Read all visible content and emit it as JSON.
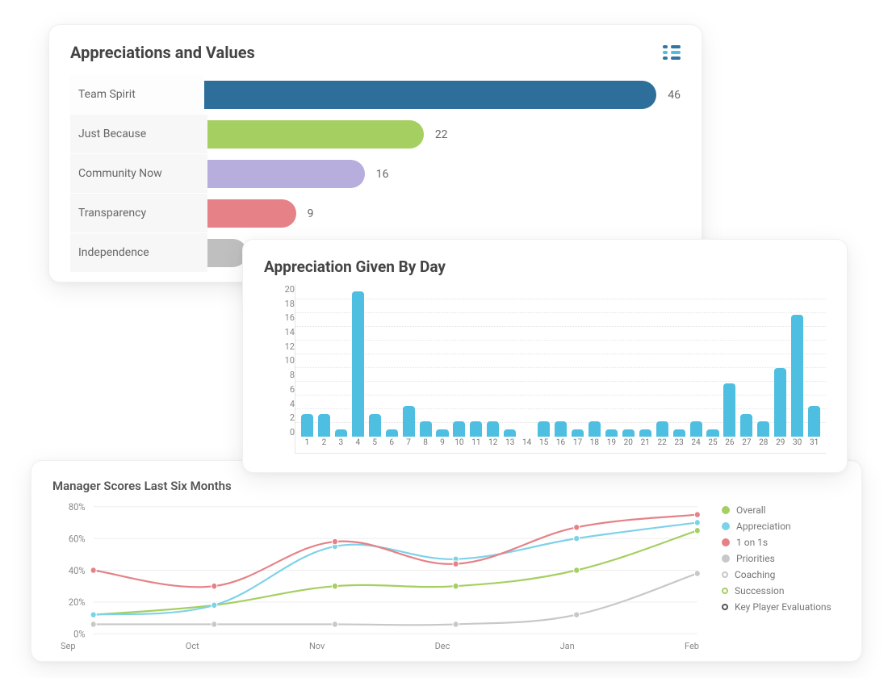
{
  "panel1": {
    "title": "Appreciations and Values",
    "legend_icon_colors": [
      "#2f77a1",
      "#4ebfe0",
      "#2f77a1"
    ]
  },
  "panel2": {
    "title": "Appreciation Given By Day"
  },
  "panel3": {
    "title": "Manager Scores Last Six Months"
  },
  "chart_data": [
    {
      "id": "appreciations_values",
      "type": "bar",
      "orientation": "horizontal",
      "title": "Appreciations and Values",
      "categories": [
        "Team Spirit",
        "Just Because",
        "Community Now",
        "Transparency",
        "Independence"
      ],
      "values": [
        46,
        22,
        16,
        9,
        4
      ],
      "colors": [
        "#2d6e9b",
        "#a5cf60",
        "#b7aedd",
        "#e58187",
        "#bfbfbf"
      ],
      "xmax": 46
    },
    {
      "id": "appreciation_by_day",
      "type": "bar",
      "orientation": "vertical",
      "title": "Appreciation Given By Day",
      "categories": [
        "1",
        "2",
        "3",
        "4",
        "5",
        "6",
        "7",
        "8",
        "9",
        "10",
        "11",
        "12",
        "13",
        "14",
        "15",
        "16",
        "17",
        "18",
        "19",
        "20",
        "21",
        "22",
        "23",
        "24",
        "25",
        "26",
        "27",
        "28",
        "29",
        "30",
        "31"
      ],
      "values": [
        3,
        3,
        1,
        19,
        3,
        1,
        4,
        2,
        1,
        2,
        2,
        2,
        1,
        0,
        2,
        2,
        1,
        2,
        1,
        1,
        1,
        2,
        1,
        2,
        1,
        7,
        3,
        2,
        9,
        16,
        4
      ],
      "color": "#4ebfe0",
      "yticks": [
        0,
        2,
        4,
        6,
        8,
        10,
        12,
        14,
        16,
        18,
        20
      ],
      "ylim": [
        0,
        20
      ]
    },
    {
      "id": "manager_scores",
      "type": "line",
      "title": "Manager Scores Last Six Months",
      "x": [
        "Sep",
        "Oct",
        "Nov",
        "Dec",
        "Jan",
        "Feb"
      ],
      "ylabel": "%",
      "yticks": [
        0,
        20,
        40,
        60,
        80
      ],
      "ylim": [
        0,
        80
      ],
      "series": [
        {
          "name": "Overall",
          "color": "#a5cf60",
          "values": [
            12,
            18,
            30,
            30,
            40,
            65
          ],
          "marker": "solid"
        },
        {
          "name": "Appreciation",
          "color": "#7dd2e8",
          "values": [
            12,
            18,
            55,
            47,
            60,
            70
          ],
          "marker": "solid"
        },
        {
          "name": "1 on 1s",
          "color": "#e58187",
          "values": [
            40,
            30,
            58,
            44,
            67,
            75
          ],
          "marker": "solid"
        },
        {
          "name": "Priorities",
          "color": "#c8c8c8",
          "values": [
            6,
            6,
            6,
            6,
            12,
            38
          ],
          "marker": "solid"
        },
        {
          "name": "Coaching",
          "color": "#c8c8c8",
          "values": null,
          "marker": "ring"
        },
        {
          "name": "Succession",
          "color": "#a5cf60",
          "values": null,
          "marker": "ring"
        },
        {
          "name": "Key Player Evaluations",
          "color": "#555555",
          "values": null,
          "marker": "ring"
        }
      ]
    }
  ]
}
